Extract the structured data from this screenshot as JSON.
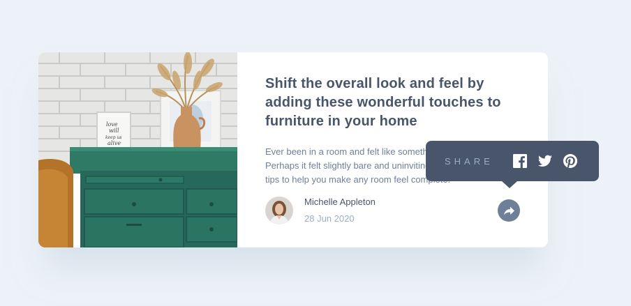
{
  "article": {
    "title": "Shift the overall look and feel by adding these wonderful touches to furniture in your home",
    "excerpt": "Ever been in a room and felt like something was missing? Perhaps it felt slightly bare and uninviting. I've got some simple tips to help you make any room feel complete."
  },
  "author": {
    "name": "Michelle Appleton",
    "date": "28 Jun 2020"
  },
  "share": {
    "label": "SHARE",
    "icons": [
      "facebook-icon",
      "twitter-icon",
      "pinterest-icon",
      "share-icon"
    ]
  },
  "photo": {
    "frame_text": [
      "love",
      "will",
      "keep us",
      "alive"
    ]
  },
  "colors": {
    "background": "#ecf2f8",
    "heading": "#48556a",
    "body": "#6e8098",
    "muted": "#9daec2",
    "tooltip": "#48556a"
  }
}
